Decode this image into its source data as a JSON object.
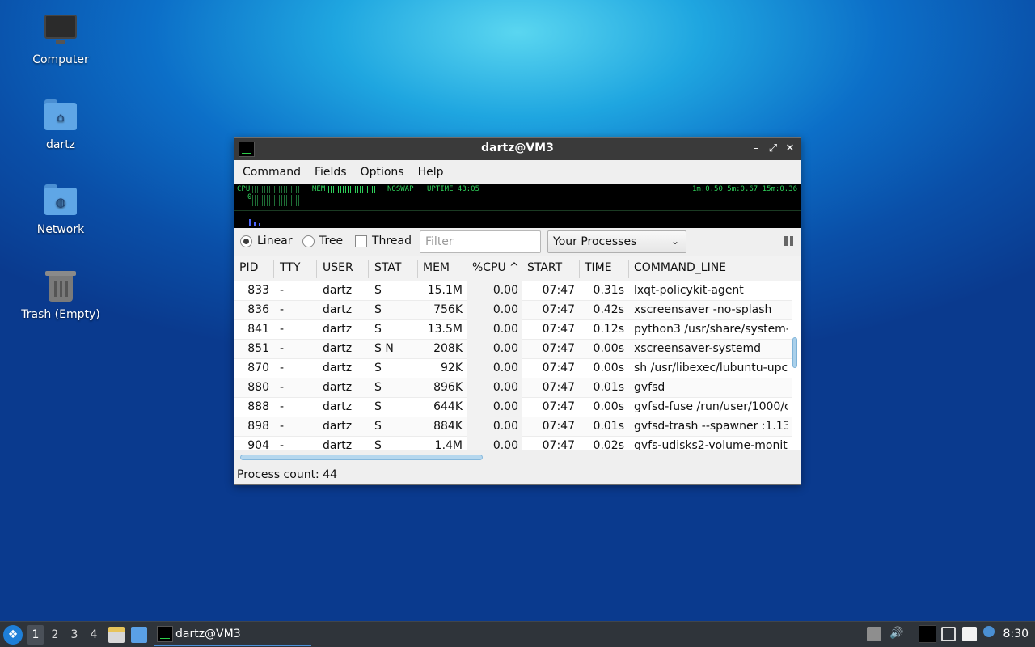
{
  "desktop": {
    "icons": [
      {
        "label": "Computer",
        "icon": "computer-icon"
      },
      {
        "label": "dartz",
        "icon": "home-folder-icon"
      },
      {
        "label": "Network",
        "icon": "network-folder-icon"
      },
      {
        "label": "Trash (Empty)",
        "icon": "trash-icon"
      }
    ]
  },
  "window": {
    "title": "dartz@VM3",
    "buttons": [
      "minimize",
      "maximize",
      "close"
    ],
    "menu": [
      "Command",
      "Fields",
      "Options",
      "Help"
    ],
    "graph": {
      "cpu_label": "CPU",
      "cpu_value": "0",
      "mem_label": "MEM",
      "swap_label": "NOSWAP",
      "uptime": "UPTIME 43:05",
      "load": "1m:0.50 5m:0.67 15m:0.36"
    },
    "toolbar": {
      "linear": "Linear",
      "tree": "Tree",
      "thread": "Thread",
      "filter_placeholder": "Filter",
      "view_select": "Your Processes"
    },
    "table": {
      "columns": [
        "PID",
        "TTY",
        "USER",
        "STAT",
        "MEM",
        "%CPU",
        "START",
        "TIME",
        "COMMAND_LINE"
      ],
      "sort_indicator": "^",
      "rows": [
        [
          "833",
          "-",
          "dartz",
          "S",
          "15.1M",
          "0.00",
          "07:47",
          "0.31s",
          "lxqt-policykit-agent"
        ],
        [
          "836",
          "-",
          "dartz",
          "S",
          "756K",
          "0.00",
          "07:47",
          "0.42s",
          "xscreensaver -no-splash"
        ],
        [
          "841",
          "-",
          "dartz",
          "S",
          "13.5M",
          "0.00",
          "07:47",
          "0.12s",
          "python3 /usr/share/system-"
        ],
        [
          "851",
          "-",
          "dartz",
          "S N",
          "208K",
          "0.00",
          "07:47",
          "0.00s",
          "xscreensaver-systemd"
        ],
        [
          "870",
          "-",
          "dartz",
          "S",
          "92K",
          "0.00",
          "07:47",
          "0.00s",
          "sh /usr/libexec/lubuntu-upc"
        ],
        [
          "880",
          "-",
          "dartz",
          "S",
          "896K",
          "0.00",
          "07:47",
          "0.01s",
          "gvfsd"
        ],
        [
          "888",
          "-",
          "dartz",
          "S",
          "644K",
          "0.00",
          "07:47",
          "0.00s",
          "gvfsd-fuse /run/user/1000/c"
        ],
        [
          "898",
          "-",
          "dartz",
          "S",
          "884K",
          "0.00",
          "07:47",
          "0.01s",
          "gvfsd-trash --spawner :1.13"
        ],
        [
          "904",
          "-",
          "dartz",
          "S",
          "1.4M",
          "0.00",
          "07:47",
          "0.02s",
          "gvfs-udisks2-volume-monito"
        ]
      ]
    },
    "status": "Process count: 44"
  },
  "taskbar": {
    "workspaces": [
      "1",
      "2",
      "3",
      "4"
    ],
    "active_workspace": "1",
    "task_label": "dartz@VM3",
    "clock": "8:30"
  }
}
